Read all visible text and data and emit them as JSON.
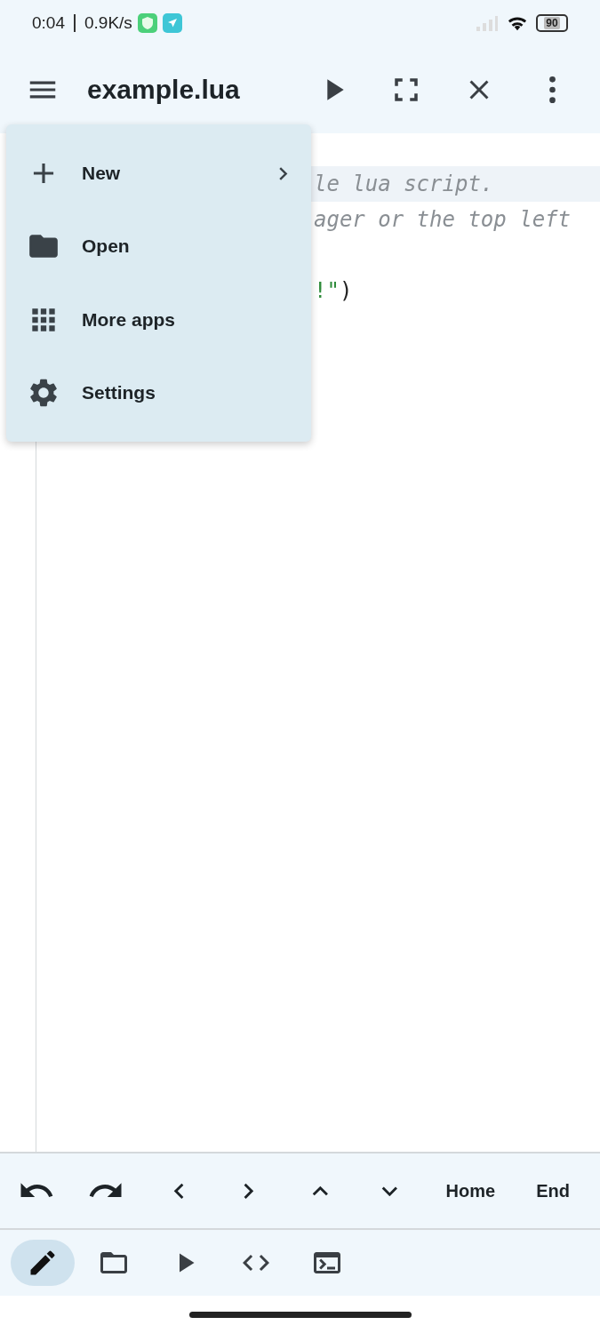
{
  "status_bar": {
    "time": "0:04",
    "speed": "0.9K/s",
    "battery": "90"
  },
  "toolbar": {
    "title": "example.lua"
  },
  "editor": {
    "lines": [
      {
        "current": true,
        "parts": [
          {
            "kind": "comment",
            "text": "le lua script."
          }
        ]
      },
      {
        "current": false,
        "parts": [
          {
            "kind": "comment",
            "text": "ager or the top left"
          }
        ]
      },
      {
        "current": false
      },
      {
        "current": false,
        "parts": [
          {
            "kind": "string",
            "text": "!\""
          },
          {
            "kind": "plain",
            "text": ")"
          }
        ]
      }
    ]
  },
  "menu": {
    "items": [
      {
        "kind": "add",
        "label": "New",
        "submenu": true
      },
      {
        "kind": "folder",
        "label": "Open",
        "submenu": false
      },
      {
        "kind": "apps",
        "label": "More apps",
        "submenu": false
      },
      {
        "kind": "gear",
        "label": "Settings",
        "submenu": false
      }
    ]
  },
  "keys": [
    {
      "kind": "undo"
    },
    {
      "kind": "redo"
    },
    {
      "kind": "left"
    },
    {
      "kind": "right"
    },
    {
      "kind": "up"
    },
    {
      "kind": "down"
    },
    {
      "kind": "text",
      "label": "Home"
    },
    {
      "kind": "text",
      "label": "End"
    }
  ],
  "nav": [
    {
      "kind": "edit",
      "selected": true
    },
    {
      "kind": "folder",
      "selected": false
    },
    {
      "kind": "run",
      "selected": false
    },
    {
      "kind": "code",
      "selected": false
    },
    {
      "kind": "terminal",
      "selected": false
    }
  ]
}
